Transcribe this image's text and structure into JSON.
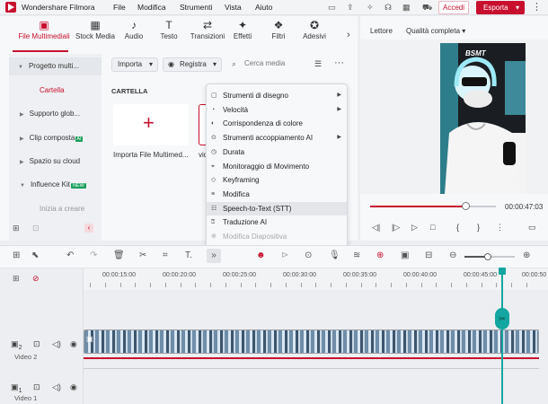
{
  "titlebar": {
    "app_title": "Wondershare Filmora",
    "menu": [
      "File",
      "Modifica",
      "Strumenti",
      "Vista",
      "Aiuto"
    ],
    "accedi_label": "Accedi",
    "esporta_label": "Esporta"
  },
  "library_tabs": [
    {
      "label": "File Multimediali",
      "icon": "folder-media-icon",
      "glyph": "▣"
    },
    {
      "label": "Stock Media",
      "icon": "stock-media-icon",
      "glyph": "▦"
    },
    {
      "label": "Audio",
      "icon": "music-note-icon",
      "glyph": "♪"
    },
    {
      "label": "Testo",
      "icon": "text-icon",
      "glyph": "T"
    },
    {
      "label": "Transizioni",
      "icon": "transition-icon",
      "glyph": "⇄"
    },
    {
      "label": "Effetti",
      "icon": "effects-icon",
      "glyph": "✦"
    },
    {
      "label": "Filtri",
      "icon": "filters-icon",
      "glyph": "❖"
    },
    {
      "label": "Adesivi",
      "icon": "sticker-icon",
      "glyph": "✪"
    }
  ],
  "sidebar": {
    "items": [
      {
        "label": "Progetto multi...",
        "badge": ""
      },
      {
        "label": "Supporto glob...",
        "badge": ""
      },
      {
        "label": "Clip composta",
        "badge": "AI"
      },
      {
        "label": "Spazio su cloud",
        "badge": ""
      },
      {
        "label": "Influence Kit",
        "badge": "NEW"
      }
    ],
    "subitem": "Cartella",
    "footer": "Inizia a creare"
  },
  "library_toolbar": {
    "import_label": "Importa",
    "record_label": "Registra",
    "search_placeholder": "Cerca media"
  },
  "media_area": {
    "folder_heading": "CARTELLA",
    "import_card_label": "Importa File Multimed...",
    "video_card_label": "vid"
  },
  "context_menu": [
    {
      "label": "Strumenti di disegno",
      "icon": "draw-icon",
      "submenu": true,
      "disabled": false,
      "highlighted": false
    },
    {
      "label": "Velocità",
      "icon": "speed-icon",
      "submenu": true,
      "disabled": false,
      "highlighted": false
    },
    {
      "label": "Corrispondenza di colore",
      "icon": "color-match-icon",
      "submenu": false,
      "disabled": false,
      "highlighted": false
    },
    {
      "label": "Strumenti accoppiamento AI",
      "icon": "ai-pairing-icon",
      "submenu": true,
      "disabled": false,
      "highlighted": false
    },
    {
      "label": "Durata",
      "icon": "duration-icon",
      "submenu": false,
      "disabled": false,
      "highlighted": false
    },
    {
      "label": "Monitoraggio di Movimento",
      "icon": "motion-tracking-icon",
      "submenu": false,
      "disabled": false,
      "highlighted": false
    },
    {
      "label": "Keyframing",
      "icon": "keyframe-icon",
      "submenu": false,
      "disabled": false,
      "highlighted": false
    },
    {
      "label": "Modifica",
      "icon": "edit-icon",
      "submenu": false,
      "disabled": false,
      "highlighted": false
    },
    {
      "label": "Speech-to-Text (STT)",
      "icon": "speech-to-text-icon",
      "submenu": false,
      "disabled": false,
      "highlighted": true
    },
    {
      "label": "Traduzione AI",
      "icon": "translate-icon",
      "submenu": false,
      "disabled": false,
      "highlighted": false
    },
    {
      "label": "Modifica Diapositiva",
      "icon": "slide-edit-icon",
      "submenu": false,
      "disabled": true,
      "highlighted": false
    }
  ],
  "preview": {
    "player_label": "Lettore",
    "quality_label": "Qualità completa",
    "video_overlay_text": "BSMT",
    "time": "00:00:47:03",
    "progress": 0.76
  },
  "timeline": {
    "ruler_labels": [
      "00:00:15:00",
      "00:00:20:00",
      "00:00:25:00",
      "00:00:30:00",
      "00:00:35:00",
      "00:00:40:00",
      "00:00:45:00",
      "00:00:50"
    ],
    "tracks": [
      {
        "name": "Video 2",
        "number": "2"
      },
      {
        "name": "Video 1",
        "number": "1"
      }
    ],
    "zoom_level": 0.46
  },
  "colors": {
    "accent": "#c8102e",
    "playhead": "#14a6a0",
    "badge_green": "#19a05c"
  }
}
